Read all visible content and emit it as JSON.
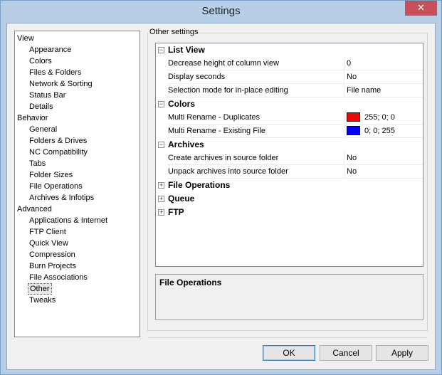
{
  "window": {
    "title": "Settings",
    "close_label": "✕"
  },
  "tree": [
    {
      "label": "View",
      "level": 0
    },
    {
      "label": "Appearance",
      "level": 1
    },
    {
      "label": "Colors",
      "level": 1
    },
    {
      "label": "Files & Folders",
      "level": 1
    },
    {
      "label": "Network & Sorting",
      "level": 1
    },
    {
      "label": "Status Bar",
      "level": 1
    },
    {
      "label": "Details",
      "level": 1
    },
    {
      "label": "Behavior",
      "level": 0
    },
    {
      "label": "General",
      "level": 1
    },
    {
      "label": "Folders & Drives",
      "level": 1
    },
    {
      "label": "NC Compatibility",
      "level": 1
    },
    {
      "label": "Tabs",
      "level": 1
    },
    {
      "label": "Folder Sizes",
      "level": 1
    },
    {
      "label": "File Operations",
      "level": 1
    },
    {
      "label": "Archives & Infotips",
      "level": 1
    },
    {
      "label": "Advanced",
      "level": 0
    },
    {
      "label": "Applications & Internet",
      "level": 1
    },
    {
      "label": "FTP Client",
      "level": 1
    },
    {
      "label": "Quick View",
      "level": 1
    },
    {
      "label": "Compression",
      "level": 1
    },
    {
      "label": "Burn Projects",
      "level": 1
    },
    {
      "label": "File Associations",
      "level": 1
    },
    {
      "label": "Other",
      "level": 1,
      "selected": true
    },
    {
      "label": "Tweaks",
      "level": 1
    }
  ],
  "group_label": "Other settings",
  "grid": [
    {
      "type": "cat",
      "label": "List View",
      "expanded": true
    },
    {
      "type": "prop",
      "name": "Decrease height of column view",
      "value": "0"
    },
    {
      "type": "prop",
      "name": "Display seconds",
      "value": "No"
    },
    {
      "type": "prop",
      "name": "Selection mode for in-place editing",
      "value": "File name"
    },
    {
      "type": "cat",
      "label": "Colors",
      "expanded": true
    },
    {
      "type": "prop",
      "name": "Multi Rename - Duplicates",
      "value": "255; 0; 0",
      "color": "#ff0000"
    },
    {
      "type": "prop",
      "name": "Multi Rename - Existing File",
      "value": "0; 0; 255",
      "color": "#0000ff"
    },
    {
      "type": "cat",
      "label": "Archives",
      "expanded": true
    },
    {
      "type": "prop",
      "name": "Create archives in source folder",
      "value": "No"
    },
    {
      "type": "prop",
      "name": "Unpack archives into source folder",
      "value": "No"
    },
    {
      "type": "cat",
      "label": "File Operations",
      "expanded": false
    },
    {
      "type": "cat",
      "label": "Queue",
      "expanded": false
    },
    {
      "type": "cat",
      "label": "FTP",
      "expanded": false
    }
  ],
  "description": {
    "title": "File Operations"
  },
  "buttons": {
    "ok": "OK",
    "cancel": "Cancel",
    "apply": "Apply"
  }
}
